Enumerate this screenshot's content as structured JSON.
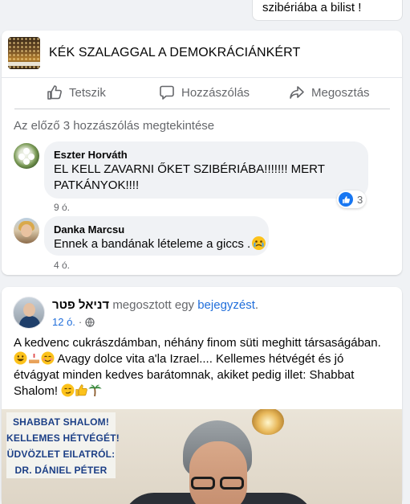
{
  "top_comment": {
    "text": "szibériába a bilist !"
  },
  "group": {
    "name": "KÉK SZALAGGAL A DEMOKRÁCIÁNKÉRT"
  },
  "actions": {
    "like": "Tetszik",
    "comment": "Hozzászólás",
    "share": "Megosztás"
  },
  "view_previous": "Az előző 3 hozzászólás megtekintése",
  "comments": [
    {
      "author": "Eszter Horváth",
      "line1": "EL KELL ZAVARNI ŐKET SZIBÉRIÁBA!!!!!!! MERT",
      "line2": "PATKÁNYOK!!!!",
      "time": "9 ó.",
      "reactions": "3"
    },
    {
      "author": "Danka Marcsu",
      "text": "Ennek a bandának lételeme a giccs .",
      "time": "4 ó."
    }
  ],
  "post": {
    "author": "דניאל פטר",
    "shared_text": "megosztott egy",
    "shared_link": "bejegyzést",
    "period": ".",
    "time": "12 ó.",
    "dot": "·",
    "line1": "A kedvenc cukrászdámban, néhány finom süti meghitt társaságában.",
    "line2": "Avagy dolce vita a'la Izrael.... Kellemes hétvégét és jó",
    "line3": "étvágyat minden kedves barátomnak, akiket pedig illet: Shabbat",
    "line4": "Shalom!",
    "image_sign": [
      "SHABBAT SHALOM!",
      "KELLEMES HÉTVÉGÉT!",
      "ÜDVÖZLET EILATRÓL:",
      "DR. DÁNIEL PÉTER"
    ]
  },
  "colors": {
    "accent": "#1877f2",
    "link": "#216fdb",
    "muted": "#65676b",
    "sign_text": "#1c3f86"
  }
}
